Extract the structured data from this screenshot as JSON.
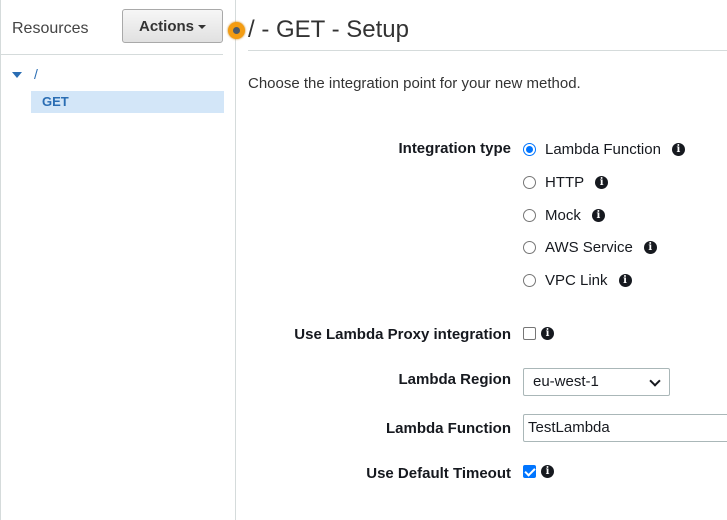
{
  "sidebar": {
    "title": "Resources",
    "actions_label": "Actions",
    "tree": {
      "root_label": "/",
      "method_label": "GET"
    }
  },
  "header": {
    "title": "/ - GET - Setup"
  },
  "intro": "Choose the integration point for your new method.",
  "form": {
    "integration_type": {
      "label": "Integration type",
      "selected": "Lambda Function",
      "options": [
        "Lambda Function",
        "HTTP",
        "Mock",
        "AWS Service",
        "VPC Link"
      ]
    },
    "lambda_proxy": {
      "label": "Use Lambda Proxy integration",
      "checked": false
    },
    "lambda_region": {
      "label": "Lambda Region",
      "value": "eu-west-1"
    },
    "lambda_function": {
      "label": "Lambda Function",
      "value": "TestLambda"
    },
    "default_timeout": {
      "label": "Use Default Timeout",
      "checked": true
    }
  },
  "colors": {
    "accent_blue": "#2a6db3",
    "selected_row_bg": "#d3e6f8",
    "control_blue": "#0075ff",
    "indicator_orange": "#f39c12"
  }
}
